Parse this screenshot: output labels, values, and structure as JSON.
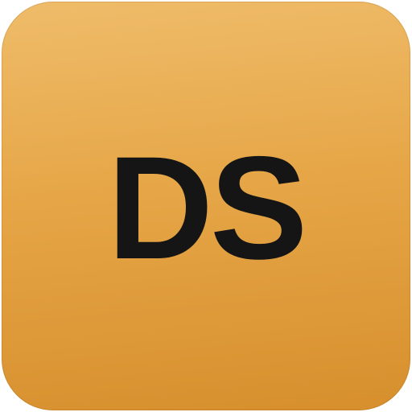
{
  "app_icon": {
    "monogram": "DS",
    "colors": {
      "tile_gradient_top": "#efbc6a",
      "tile_gradient_bottom": "#d78f2d",
      "text": "#151515"
    }
  }
}
